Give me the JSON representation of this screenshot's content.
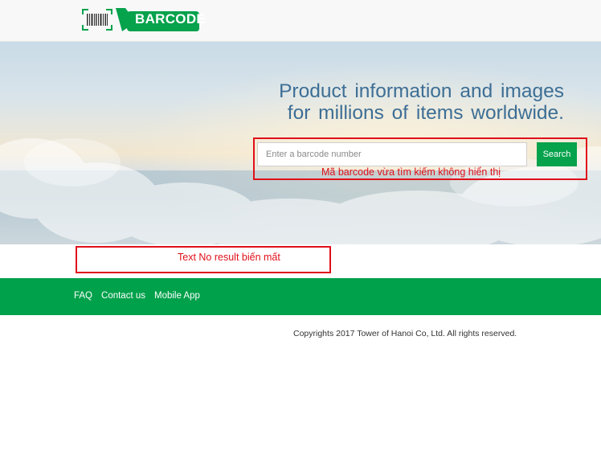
{
  "brand": {
    "name": "BARCODE",
    "color": "#06a24c"
  },
  "hero": {
    "tagline_line1": "Product information and images",
    "tagline_line2": "for millions of items worldwide."
  },
  "search": {
    "placeholder": "Enter a barcode number",
    "value": "",
    "button_label": "Search"
  },
  "annotations": {
    "search_note": "Mã barcode vừa tìm kiếm không hiển thị",
    "result_note": "Text No result biến mất"
  },
  "footer": {
    "links": [
      "FAQ",
      "Contact us",
      "Mobile App"
    ],
    "copyright": "Copyrights 2017 Tower of Hanoi Co, Ltd. All rights reserved."
  },
  "icons": {
    "logo_scan": "barcode-scan-icon"
  },
  "colors": {
    "accent": "#00a14b",
    "tagline": "#3d6e95",
    "annotation": "#e0101a"
  }
}
